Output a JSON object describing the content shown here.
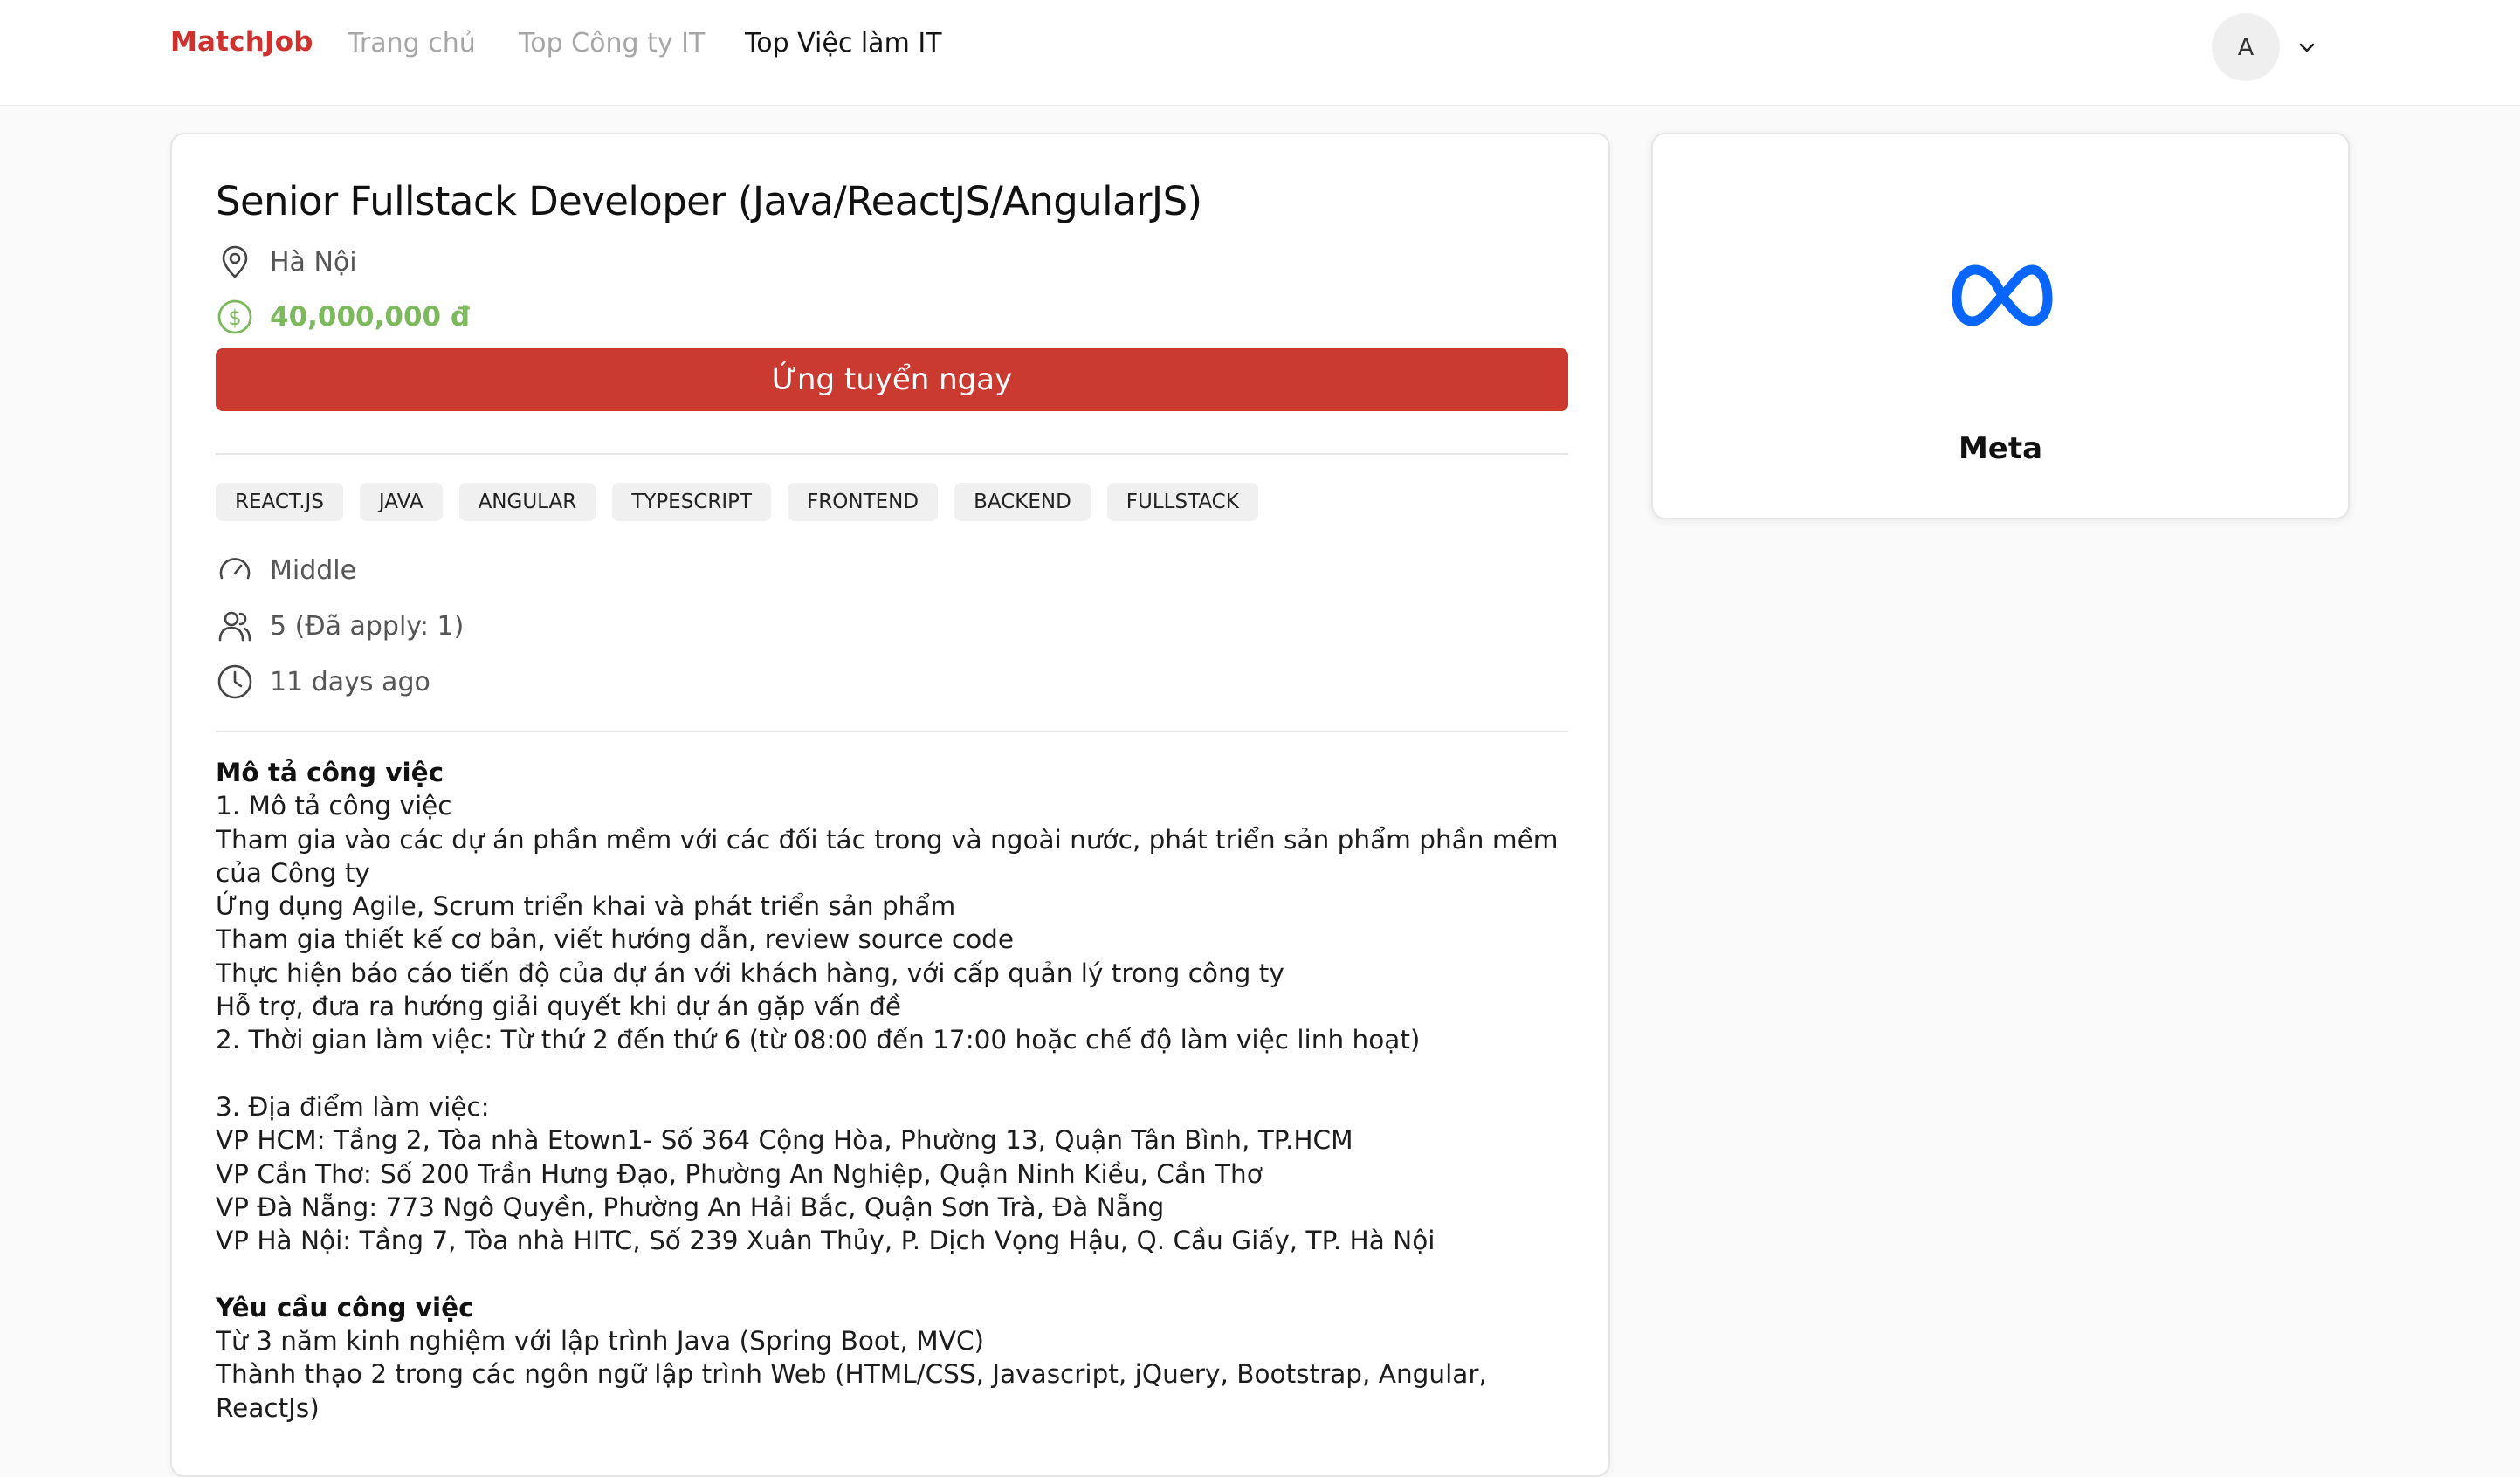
{
  "header": {
    "brand": "MatchJob",
    "nav": {
      "home": "Trang chủ",
      "companies": "Top Công ty IT",
      "jobs": "Top Việc làm IT"
    },
    "avatar_initial": "A"
  },
  "job": {
    "title": "Senior Fullstack Developer (Java/ReactJS/AngularJS)",
    "location": "Hà Nội",
    "salary": "40,000,000 đ",
    "apply_label": "Ứng tuyển ngay",
    "tags": [
      "REACT.JS",
      "JAVA",
      "ANGULAR",
      "TYPESCRIPT",
      "FRONTEND",
      "BACKEND",
      "FULLSTACK"
    ],
    "level": "Middle",
    "quantity": "5 (Đã apply: 1)",
    "posted": "11 days ago",
    "description": {
      "title": "Mô tả công việc",
      "lines": [
        "1. Mô tả công việc",
        "Tham gia vào các dự án phần mềm với các đối tác trong và ngoài nước, phát triển sản phẩm phần mềm của Công ty",
        "Ứng dụng Agile, Scrum triển khai và phát triển sản phẩm",
        "Tham gia thiết kế cơ bản, viết hướng dẫn, review source code",
        "Thực hiện báo cáo tiến độ của dự án với khách hàng, với cấp quản lý trong công ty",
        "Hỗ trợ, đưa ra hướng giải quyết khi dự án gặp vấn đề",
        "2. Thời gian làm việc: Từ thứ 2 đến thứ 6 (từ 08:00 đến 17:00 hoặc chế độ làm việc linh hoạt)",
        "",
        "3. Địa điểm làm việc:",
        "VP HCM: Tầng 2, Tòa nhà Etown1- Số 364 Cộng Hòa, Phường 13, Quận Tân Bình, TP.HCM",
        "VP Cần Thơ: Số 200 Trần Hưng Đạo, Phường An Nghiệp, Quận Ninh Kiều, Cần Thơ",
        "VP Đà Nẵng: 773 Ngô Quyền, Phường An Hải Bắc, Quận Sơn Trà, Đà Nẵng",
        "VP Hà Nội: Tầng 7, Tòa nhà HITC, Số 239 Xuân Thủy, P. Dịch Vọng Hậu, Q. Cầu Giấy, TP. Hà Nội"
      ]
    },
    "requirements": {
      "title": "Yêu cầu công việc",
      "lines": [
        "Từ 3 năm kinh nghiệm với lập trình Java (Spring Boot, MVC)",
        "Thành thạo 2 trong các ngôn ngữ lập trình Web (HTML/CSS, Javascript, jQuery, Bootstrap, Angular, ReactJs)"
      ]
    }
  },
  "company": {
    "name": "Meta",
    "logo_icon": "meta-logo-icon",
    "logo_color": "#0866ff"
  },
  "colors": {
    "brand": "#d0312d",
    "apply_button": "#cb3a31",
    "salary": "#7cb85c"
  }
}
